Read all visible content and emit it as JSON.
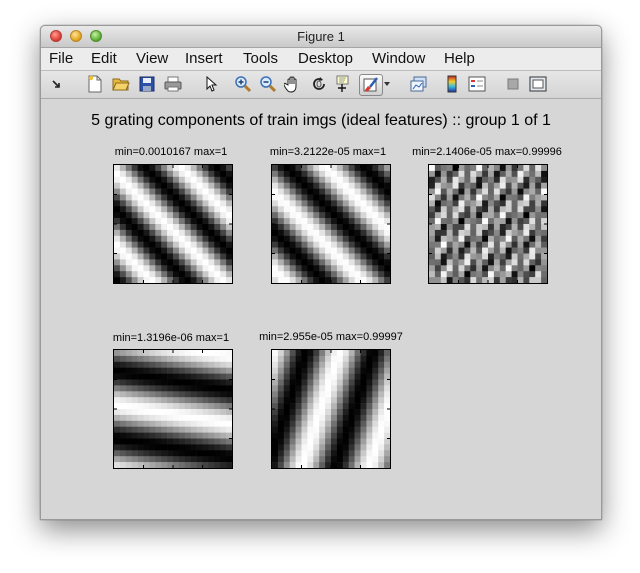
{
  "window": {
    "title": "Figure 1"
  },
  "menu": [
    {
      "label": "File"
    },
    {
      "label": "Edit"
    },
    {
      "label": "View"
    },
    {
      "label": "Insert"
    },
    {
      "label": "Tools"
    },
    {
      "label": "Desktop"
    },
    {
      "label": "Window"
    },
    {
      "label": "Help"
    }
  ],
  "toolbar": [
    {
      "name": "dock-arrow-icon"
    },
    {
      "name": "new-figure-icon"
    },
    {
      "name": "open-file-icon"
    },
    {
      "name": "save-figure-icon"
    },
    {
      "name": "print-figure-icon"
    },
    {
      "name": "edit-plot-pointer-icon"
    },
    {
      "name": "zoom-in-icon"
    },
    {
      "name": "zoom-out-icon"
    },
    {
      "name": "pan-hand-icon"
    },
    {
      "name": "rotate-3d-icon"
    },
    {
      "name": "data-cursor-icon"
    },
    {
      "name": "brush-icon"
    },
    {
      "name": "brush-dropdown-icon"
    },
    {
      "name": "link-plot-icon"
    },
    {
      "name": "insert-colorbar-icon"
    },
    {
      "name": "insert-legend-icon"
    },
    {
      "name": "hide-plot-tools-icon"
    },
    {
      "name": "show-plot-tools-icon"
    }
  ],
  "figure": {
    "title": "5 grating components of train imgs (ideal features) :: group 1 of 1",
    "subplots": [
      {
        "label": "min=0.0010167 max=1"
      },
      {
        "label": "min=3.2122e-05 max=1"
      },
      {
        "label": "min=2.1406e-05 max=0.99996"
      },
      {
        "label": "min=1.3196e-06 max=1"
      },
      {
        "label": "min=2.955e-05 max=0.99997"
      }
    ]
  }
}
